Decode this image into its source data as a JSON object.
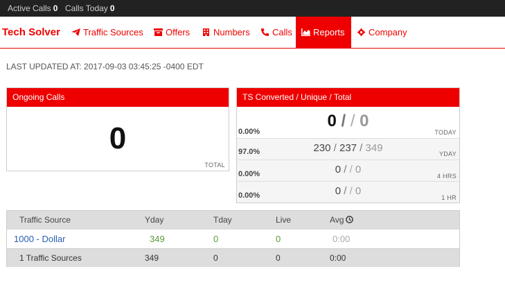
{
  "topbar": {
    "active_calls_label": "Active Calls",
    "active_calls_value": "0",
    "calls_today_label": "Calls Today",
    "calls_today_value": "0"
  },
  "nav": {
    "brand": "Tech Solver",
    "items": [
      {
        "label": "Traffic Sources",
        "icon": "paper-plane-icon"
      },
      {
        "label": "Offers",
        "icon": "archive-icon"
      },
      {
        "label": "Numbers",
        "icon": "building-icon"
      },
      {
        "label": "Calls",
        "icon": "phone-icon"
      },
      {
        "label": "Reports",
        "icon": "area-chart-icon",
        "active": true
      },
      {
        "label": "Company",
        "icon": "gear-icon"
      }
    ]
  },
  "last_updated": "LAST UPDATED AT: 2017-09-03 03:45:25 -0400 EDT",
  "ongoing": {
    "title": "Ongoing Calls",
    "value": "0",
    "footer": "TOTAL"
  },
  "ts": {
    "title": "TS Converted / Unique / Total",
    "rows": [
      {
        "pct": "0.00%",
        "converted": "0",
        "unique": "",
        "total": "0",
        "label": "TODAY"
      },
      {
        "pct": "97.0%",
        "converted": "230",
        "unique": "237",
        "total": "349",
        "label": "YDAY"
      },
      {
        "pct": "0.00%",
        "converted": "0",
        "unique": "",
        "total": "0",
        "label": "4 HRS"
      },
      {
        "pct": "0.00%",
        "converted": "0",
        "unique": "",
        "total": "0",
        "label": "1 HR"
      }
    ]
  },
  "table": {
    "headers": {
      "source": "Traffic Source",
      "yday": "Yday",
      "tday": "Tday",
      "live": "Live",
      "avg": "Avg"
    },
    "rows": [
      {
        "source": "1000 - Dollar",
        "yday": "349",
        "tday": "0",
        "live": "0",
        "avg": "0:00"
      }
    ],
    "footer": {
      "source": "1 Traffic Sources",
      "yday": "349",
      "tday": "0",
      "live": "0",
      "avg": "0:00"
    }
  },
  "colors": {
    "brand": "#ee0000",
    "topbar": "#222222"
  }
}
